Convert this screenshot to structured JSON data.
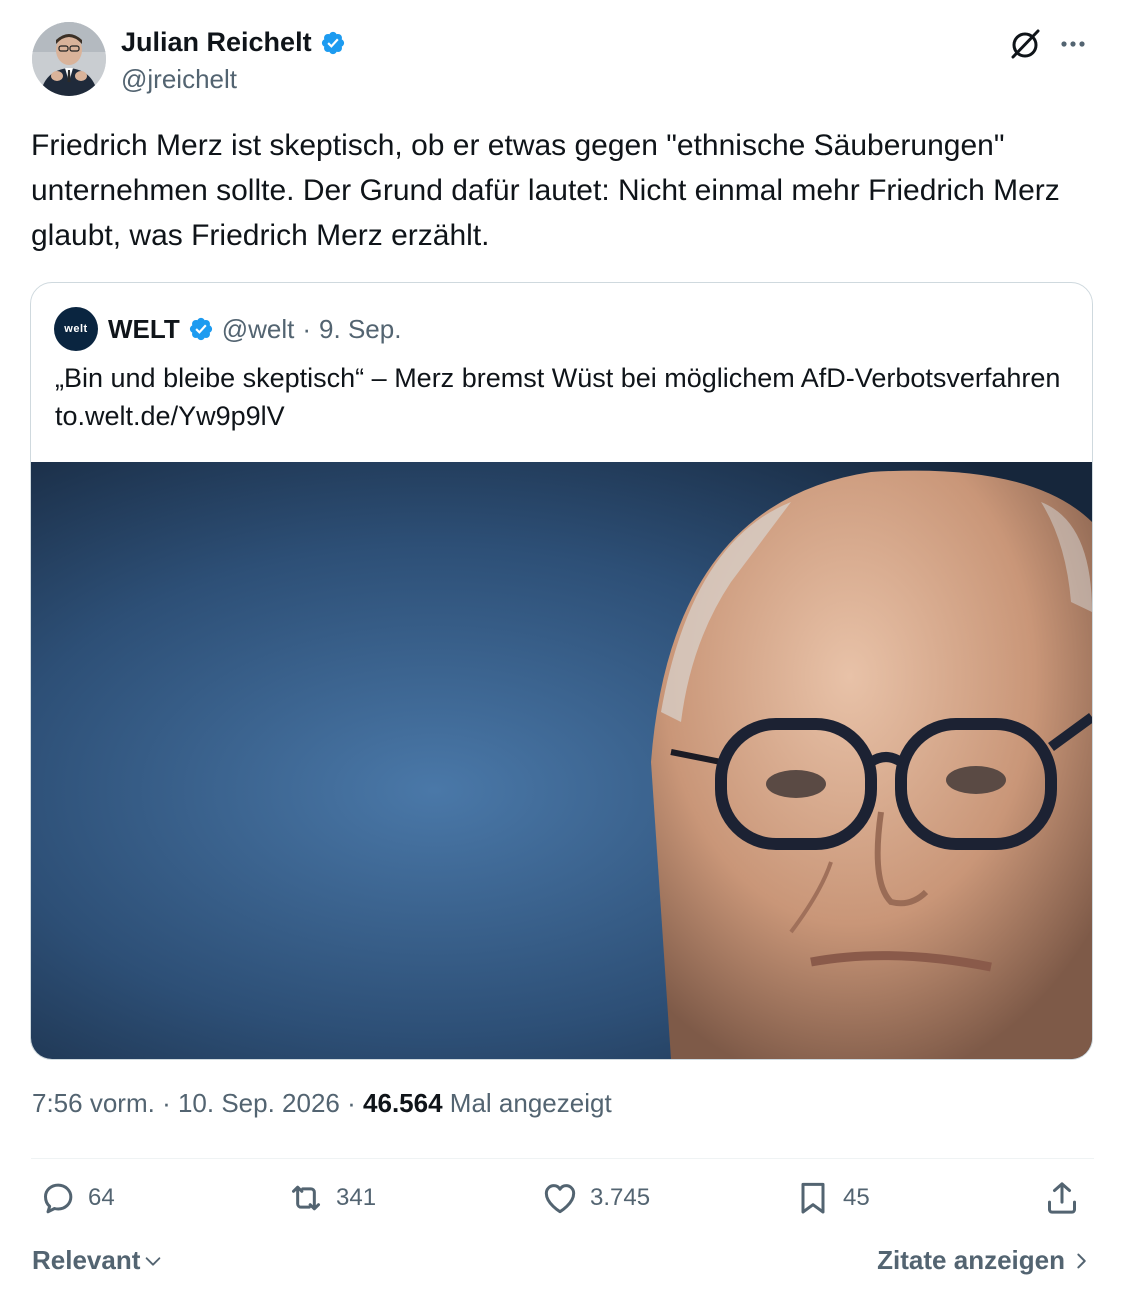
{
  "author": {
    "name": "Julian Reichelt",
    "handle": "@jreichelt"
  },
  "icons": {
    "grok": "grok-icon",
    "more": "more-icon",
    "verified": "verified-badge-icon"
  },
  "tweet": {
    "text": "Friedrich Merz ist skeptisch, ob er etwas gegen \"ethnische Säuberungen\" unternehmen sollte. Der Grund dafür lautet: Nicht einmal mehr Friedrich Merz glaubt, was Friedrich Merz erzählt."
  },
  "quote": {
    "logo_text": "welt",
    "name": "WELT",
    "handle": "@welt",
    "separator": "·",
    "date": "9. Sep.",
    "text": "„Bin und bleibe skeptisch“ – Merz bremst Wüst bei möglichem AfD-Verbotsverfahren to.welt.de/Yw9p9lV"
  },
  "meta": {
    "time": "7:56 vorm.",
    "sep1": "·",
    "date": "10. Sep. 2026",
    "sep2": "·",
    "views": "46.564",
    "views_label": "Mal angezeigt"
  },
  "actions": {
    "replies": "64",
    "reposts": "341",
    "likes": "3.745",
    "bookmarks": "45"
  },
  "footer": {
    "sort_label": "Relevant",
    "quotes_label": "Zitate anzeigen"
  },
  "colors": {
    "verified": "#1d9bf0",
    "secondary": "#536471",
    "primary_text": "#0f1419",
    "border": "#cfd9de"
  }
}
